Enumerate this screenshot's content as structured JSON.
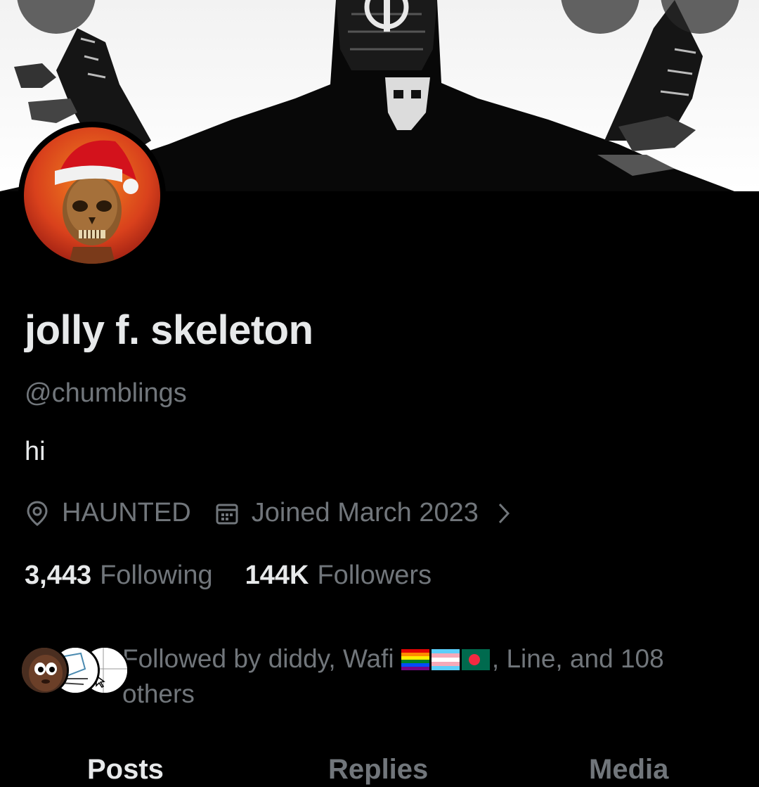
{
  "profile": {
    "display_name": "jolly f. skeleton",
    "handle": "@chumblings",
    "bio": "hi",
    "location": "HAUNTED",
    "joined": "Joined March 2023",
    "following_count": "3,443",
    "following_label": "Following",
    "followers_count": "144K",
    "followers_label": "Followers"
  },
  "followed_by": {
    "prefix": "Followed by diddy, Wafi",
    "suffix": ", Line, and 108 others"
  },
  "tabs": [
    {
      "label": "Posts",
      "active": true
    },
    {
      "label": "Replies",
      "active": false
    },
    {
      "label": "Media",
      "active": false
    }
  ],
  "icons": {
    "back": "back-arrow-icon",
    "search": "search-icon",
    "more": "more-icon",
    "location": "location-pin-icon",
    "calendar": "calendar-icon",
    "chevron": "chevron-right-icon"
  },
  "colors": {
    "background": "#000000",
    "primary_text": "#e7e9ea",
    "secondary_text": "#71767b"
  }
}
